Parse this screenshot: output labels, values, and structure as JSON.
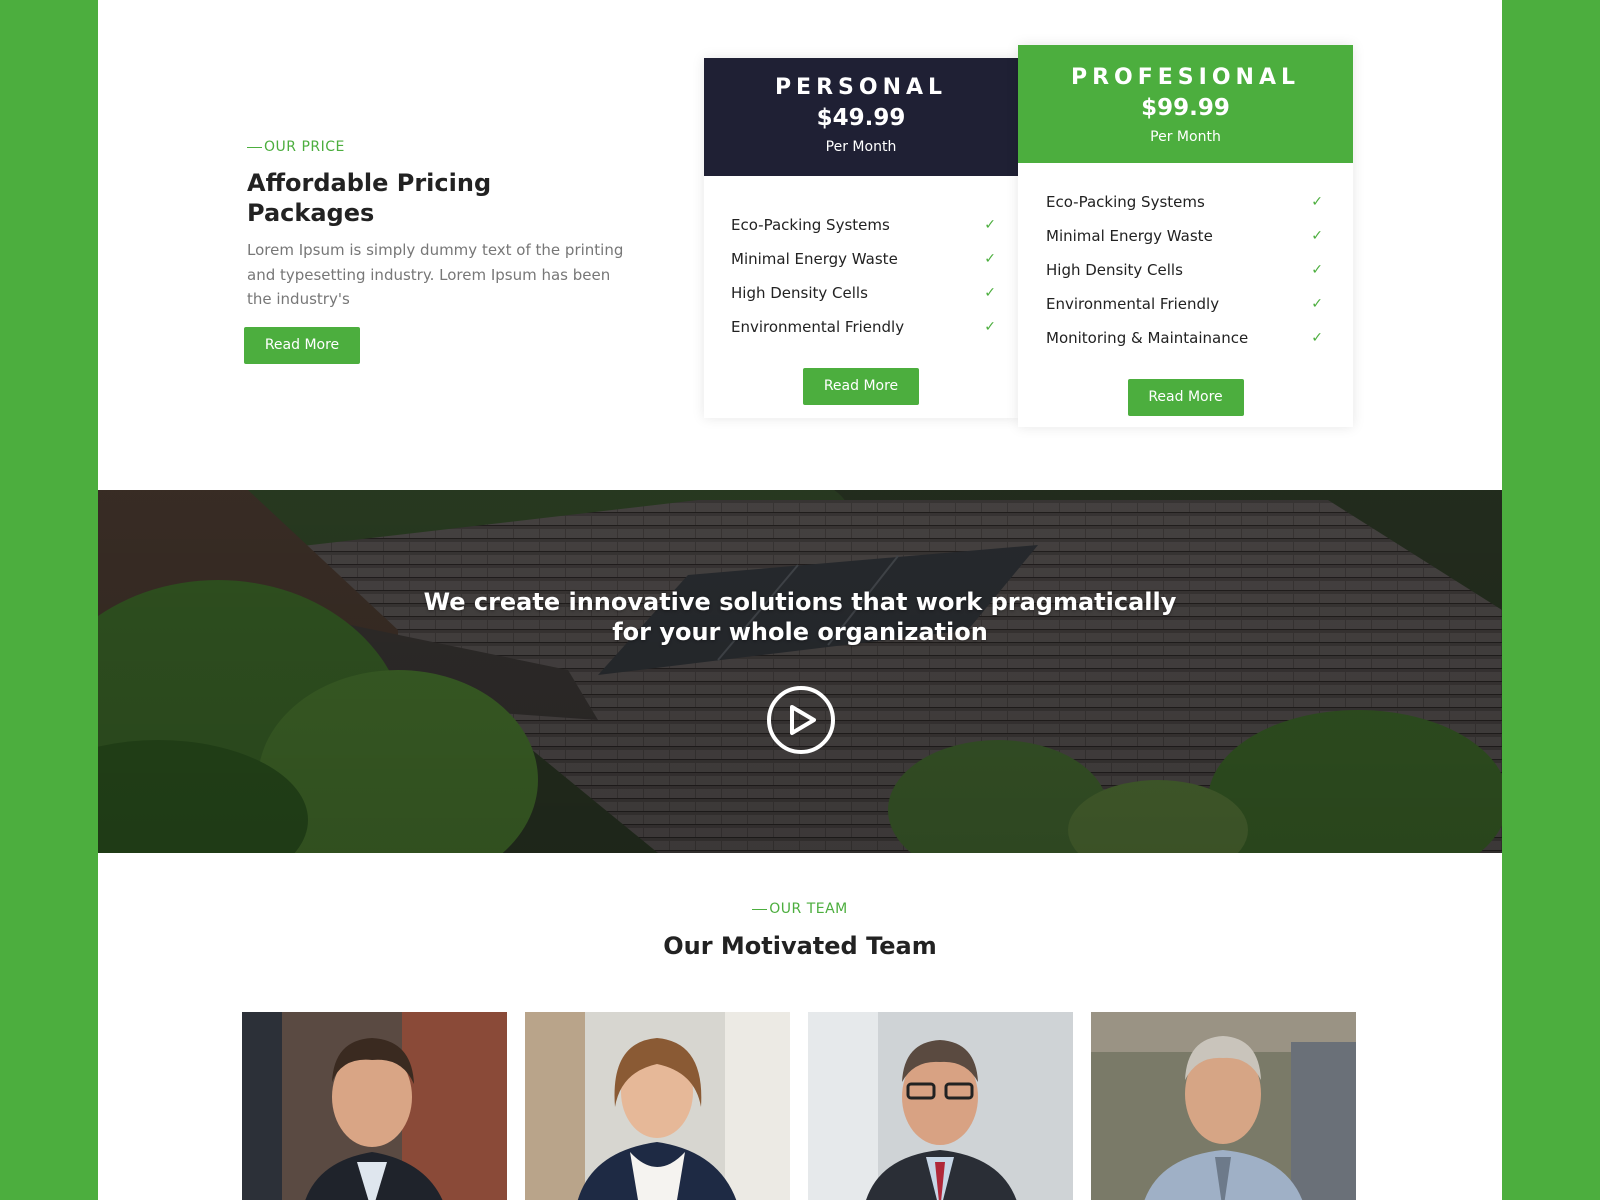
{
  "pricing": {
    "eyebrow": "OUR PRICE",
    "title": "Affordable Pricing Packages",
    "description": "Lorem Ipsum is simply dummy text of the printing and typesetting industry. Lorem Ipsum has been the industry's",
    "button_label": "Read More",
    "plans": [
      {
        "name": "PERSONAL",
        "price": "$49.99",
        "period": "Per Month",
        "features": [
          "Eco-Packing Systems",
          "Minimal Energy Waste",
          "High Density Cells",
          "Environmental Friendly"
        ],
        "button_label": "Read More",
        "header_color": "#1f2034"
      },
      {
        "name": "PROFESIONAL",
        "price": "$99.99",
        "period": "Per Month",
        "features": [
          "Eco-Packing Systems",
          "Minimal Energy Waste",
          "High Density Cells",
          "Environmental Friendly",
          "Monitoring & Maintainance"
        ],
        "button_label": "Read More",
        "header_color": "#4cae3e"
      }
    ],
    "check_icon": "check-icon"
  },
  "banner": {
    "line1": "We create innovative solutions that work pragmatically",
    "line2": "for your whole organization",
    "play_icon": "play-icon"
  },
  "team": {
    "eyebrow": "OUR TEAM",
    "title": "Our Motivated Team",
    "member_photos": [
      "member-photo-1",
      "member-photo-2",
      "member-photo-3",
      "member-photo-4"
    ]
  },
  "colors": {
    "accent": "#4cae3e",
    "dark": "#1f2034",
    "text": "#222222",
    "muted": "#777777"
  }
}
